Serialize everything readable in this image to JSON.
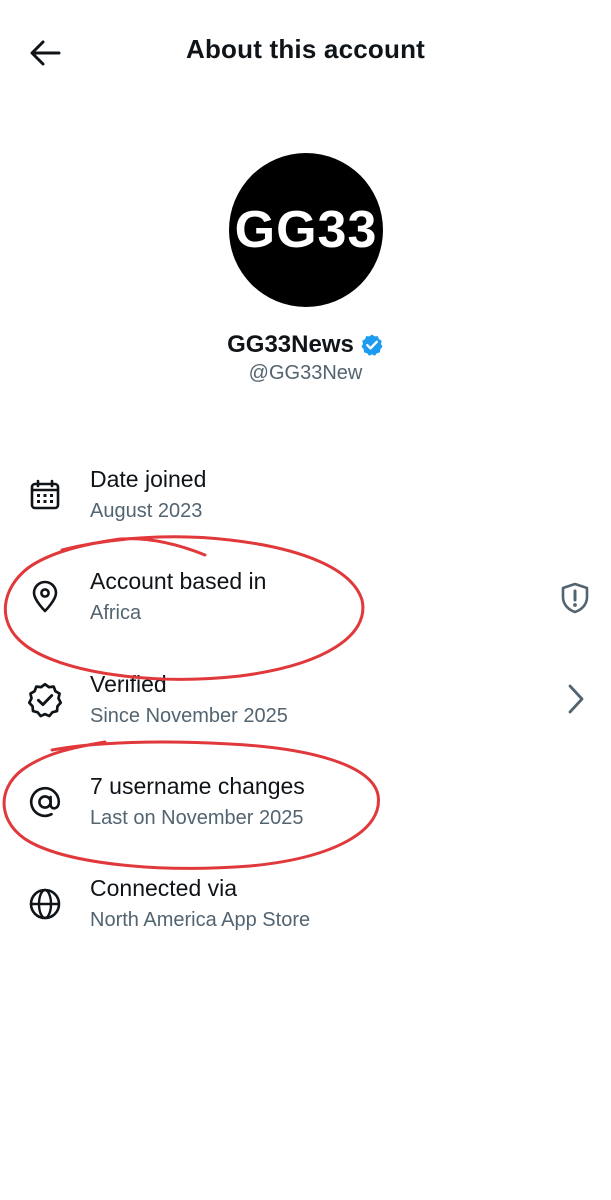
{
  "header": {
    "title": "About this account",
    "back_icon": "arrow-left-icon"
  },
  "profile": {
    "avatar_text": "GG33",
    "display_name": "GG33News",
    "handle": "@GG33New",
    "verified_badge_icon": "verified-badge-icon",
    "verified_color": "#1d9bf0"
  },
  "info_rows": [
    {
      "label": "Date joined",
      "value": "August 2023",
      "icon": "calendar-icon"
    },
    {
      "label": "Account based in",
      "value": "Africa",
      "icon": "location-pin-icon",
      "trailing_icon": "shield-alert-icon"
    },
    {
      "label": "Verified",
      "value": "Since November 2025",
      "icon": "verified-check-icon",
      "trailing_icon": "chevron-right-icon"
    },
    {
      "label": "7 username changes",
      "value": "Last on November 2025",
      "icon": "at-sign-icon"
    },
    {
      "label": "Connected via",
      "value": "North America App Store",
      "icon": "globe-icon"
    }
  ],
  "annotation": {
    "color": "#e0383b",
    "circled_rows": [
      "Account based in",
      "7 username changes"
    ]
  }
}
